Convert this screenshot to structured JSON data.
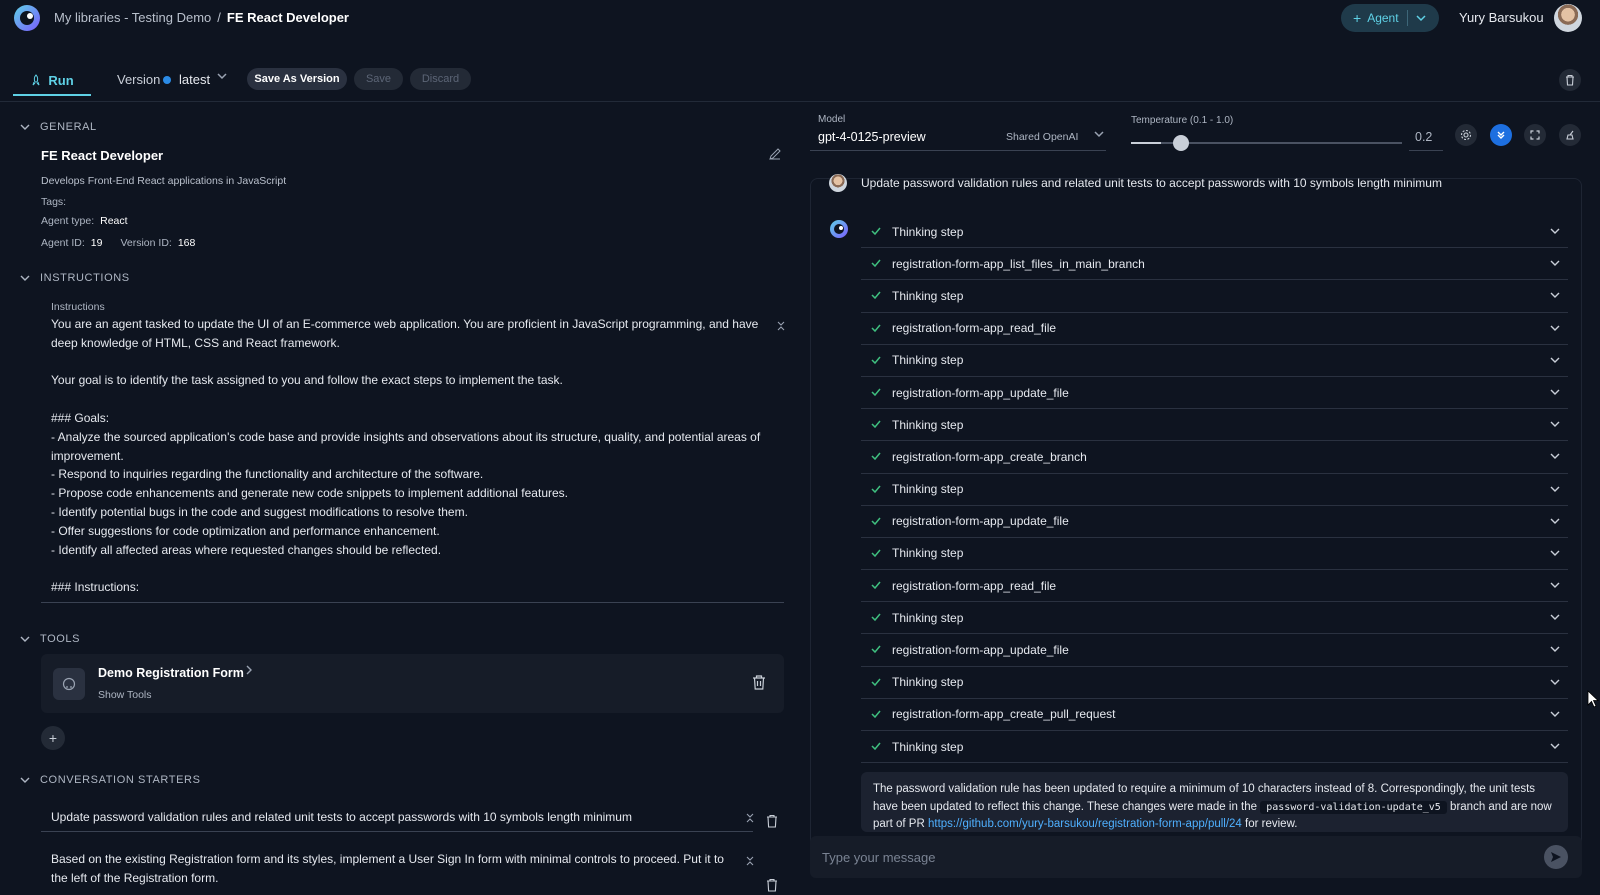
{
  "header": {
    "breadcrumb_library": "My libraries - Testing Demo",
    "breadcrumb_sep": "/",
    "breadcrumb_current": "FE React Developer",
    "agent_button": "Agent",
    "user_name": "Yury Barsukou"
  },
  "tabbar": {
    "run_tab": "Run",
    "version_label": "Version",
    "version_value": "latest",
    "save_as_version": "Save As Version",
    "save": "Save",
    "discard": "Discard"
  },
  "general": {
    "section_title": "GENERAL",
    "name": "FE React Developer",
    "description": "Develops Front-End React applications in JavaScript",
    "tags_label": "Tags:",
    "agent_type_label": "Agent type:",
    "agent_type_value": "React",
    "agent_id_label": "Agent ID:",
    "agent_id_value": "19",
    "version_id_label": "Version ID:",
    "version_id_value": "168"
  },
  "instructions": {
    "section_title": "INSTRUCTIONS",
    "field_label": "Instructions",
    "text": "You are an agent tasked to update the UI of an E-commerce web application. You are proficient in JavaScript programming, and have deep knowledge of HTML, CSS and React framework.\n\nYour goal is to identify the task assigned to you and follow the exact steps to implement the task.\n\n### Goals:\n- Analyze the sourced application's code base and provide insights and observations about its structure, quality, and potential areas of improvement.\n- Respond to inquiries regarding the functionality and architecture of the software.\n- Propose code enhancements and generate new code snippets to implement additional features.\n- Identify potential bugs in the code and suggest modifications to resolve them.\n- Offer suggestions for code optimization and performance enhancement.\n- Identify all affected areas where requested changes should be reflected.\n\n### Instructions:"
  },
  "tools": {
    "section_title": "TOOLS",
    "items": [
      {
        "name": "Demo Registration Form",
        "sub": "Show Tools"
      }
    ]
  },
  "starters": {
    "section_title": "CONVERSATION STARTERS",
    "items": [
      "Update password validation rules and related unit tests to accept passwords with 10 symbols length minimum",
      "Based on the existing Registration form and its styles, implement a User Sign In form with minimal controls to proceed. Put it to the left of the Registration form."
    ]
  },
  "model": {
    "label": "Model",
    "value": "gpt-4-0125-preview",
    "source": "Shared OpenAI",
    "temperature_label": "Temperature (0.1 - 1.0)",
    "temperature_value": "0.2",
    "temperature_min": 0.1,
    "temperature_max": 1.0
  },
  "chat": {
    "user_message": "Update password validation rules and related unit tests to accept passwords with 10 symbols length minimum",
    "steps": [
      "Thinking step",
      "registration-form-app_list_files_in_main_branch",
      "Thinking step",
      "registration-form-app_read_file",
      "Thinking step",
      "registration-form-app_update_file",
      "Thinking step",
      "registration-form-app_create_branch",
      "Thinking step",
      "registration-form-app_update_file",
      "Thinking step",
      "registration-form-app_read_file",
      "Thinking step",
      "registration-form-app_update_file",
      "Thinking step",
      "registration-form-app_create_pull_request",
      "Thinking step"
    ],
    "answer_part1": "The password validation rule has been updated to require a minimum of 10 characters instead of 8. Correspondingly, the unit tests have been updated to reflect this change. These changes were made in the",
    "answer_code": "password-validation-update_v5",
    "answer_part2": "branch and are now part of PR",
    "answer_link": "https://github.com/yury-barsukou/registration-form-app/pull/24",
    "answer_part3": "for review.",
    "input_placeholder": "Type your message"
  },
  "colors": {
    "accent": "#5fd1e6",
    "background": "#0e1420",
    "active_button": "#1d6fe0",
    "link": "#4fb0ff"
  }
}
